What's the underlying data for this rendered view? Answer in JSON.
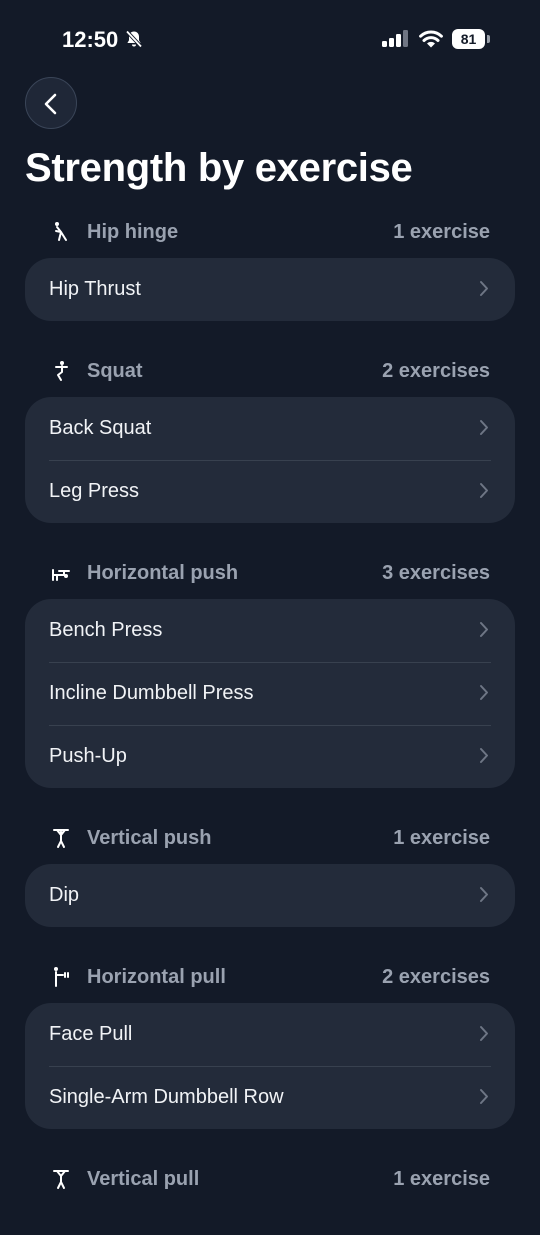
{
  "status": {
    "time": "12:50",
    "battery": "81"
  },
  "header": {
    "title": "Strength by exercise"
  },
  "sections": [
    {
      "name": "Hip hinge",
      "count": "1 exercise",
      "icon": "hip-hinge-icon",
      "items": [
        "Hip Thrust"
      ]
    },
    {
      "name": "Squat",
      "count": "2 exercises",
      "icon": "squat-icon",
      "items": [
        "Back Squat",
        "Leg Press"
      ]
    },
    {
      "name": "Horizontal push",
      "count": "3 exercises",
      "icon": "horizontal-push-icon",
      "items": [
        "Bench Press",
        "Incline Dumbbell Press",
        "Push-Up"
      ]
    },
    {
      "name": "Vertical push",
      "count": "1 exercise",
      "icon": "vertical-push-icon",
      "items": [
        "Dip"
      ]
    },
    {
      "name": "Horizontal pull",
      "count": "2 exercises",
      "icon": "horizontal-pull-icon",
      "items": [
        "Face Pull",
        "Single-Arm Dumbbell Row"
      ]
    },
    {
      "name": "Vertical pull",
      "count": "1 exercise",
      "icon": "vertical-pull-icon",
      "items": []
    }
  ],
  "colors": {
    "background": "#131a28",
    "card": "#232b3a",
    "muted_text": "#9aa2b0"
  }
}
